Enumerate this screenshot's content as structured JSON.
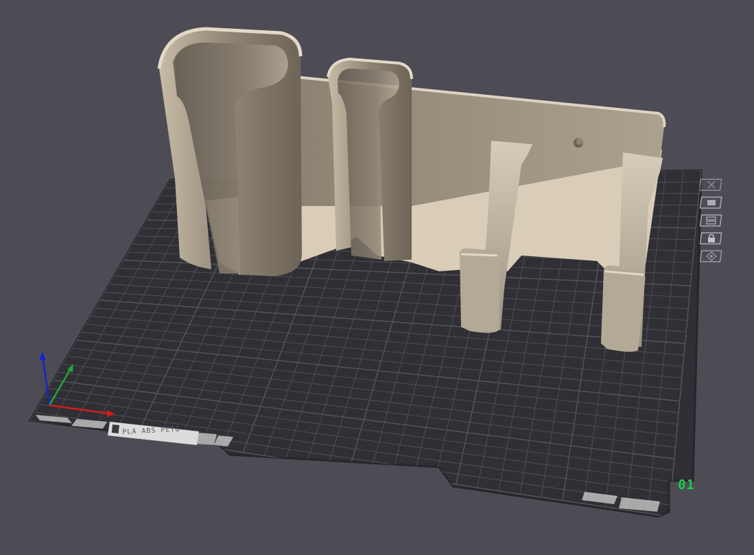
{
  "plate": {
    "index_label": "01",
    "material_label": "PLA ABS PETG"
  },
  "toolbar": {
    "buttons": [
      {
        "name": "delete-plate-button",
        "icon": "close-icon"
      },
      {
        "name": "auto-orient-button",
        "icon": "orient-icon"
      },
      {
        "name": "arrange-button",
        "icon": "arrange-icon"
      },
      {
        "name": "lock-plate-button",
        "icon": "lock-icon"
      },
      {
        "name": "plate-settings-button",
        "icon": "settings-icon"
      }
    ]
  },
  "colors": {
    "background": "#4d4c55",
    "bed": "#2f2f35",
    "grid": "#55555d",
    "model": "#c9bda9",
    "axis_x": "#d51a1a",
    "axis_y": "#1ea63a",
    "axis_z": "#1a23c8",
    "index_label": "#1fc94f"
  }
}
